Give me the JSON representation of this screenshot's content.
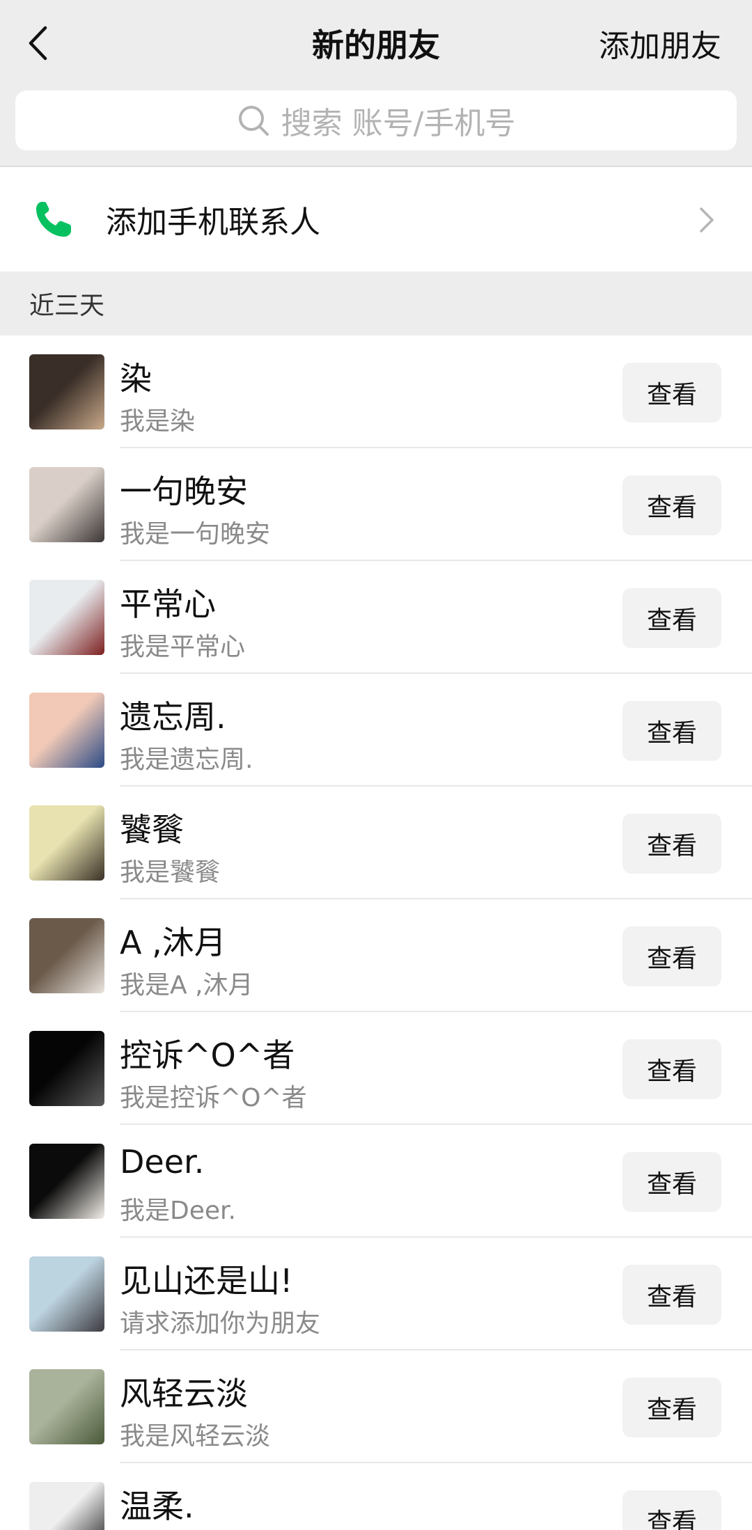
{
  "nav": {
    "title": "新的朋友",
    "action_label": "添加朋友"
  },
  "search": {
    "placeholder": "搜索 账号/手机号"
  },
  "phone_contacts": {
    "label": "添加手机联系人"
  },
  "section": {
    "label": "近三天"
  },
  "items": [
    {
      "name": "染",
      "message": "我是染",
      "button": "查看",
      "avatar_colors": [
        "#3a2e28",
        "#c9a98a"
      ]
    },
    {
      "name": "一句晚安",
      "message": "我是一句晚安",
      "button": "查看",
      "avatar_colors": [
        "#d9cfc8",
        "#3b3534"
      ]
    },
    {
      "name": "平常心",
      "message": "我是平常心",
      "button": "查看",
      "avatar_colors": [
        "#e8ecef",
        "#7d1f1f"
      ]
    },
    {
      "name": "遗忘周.",
      "message": "我是遗忘周.",
      "button": "查看",
      "avatar_colors": [
        "#f1c9b6",
        "#2b4a86"
      ]
    },
    {
      "name": "饕餮",
      "message": "我是饕餮",
      "button": "查看",
      "avatar_colors": [
        "#e7e2b0",
        "#3a3026"
      ]
    },
    {
      "name": "A ,沐月",
      "message": "我是A ,沐月",
      "button": "查看",
      "avatar_colors": [
        "#6b5a4a",
        "#e9e4de"
      ]
    },
    {
      "name": "控诉^O^者",
      "message": "我是控诉^O^者",
      "button": "查看",
      "avatar_colors": [
        "#050505",
        "#5a5a5a"
      ]
    },
    {
      "name": "Deer.",
      "message": "我是Deer.",
      "button": "查看",
      "avatar_colors": [
        "#0b0b0b",
        "#f4f0ea"
      ]
    },
    {
      "name": "见山还是山!",
      "message": "请求添加你为朋友",
      "button": "查看",
      "avatar_colors": [
        "#bcd3e0",
        "#3d3a40"
      ]
    },
    {
      "name": "风轻云淡",
      "message": "我是风轻云淡",
      "button": "查看",
      "avatar_colors": [
        "#a9b29a",
        "#4b5a3a"
      ]
    },
    {
      "name": "温柔.",
      "message": "",
      "button": "查看",
      "avatar_colors": [
        "#eeeeee",
        "#151515"
      ]
    }
  ],
  "colors": {
    "accent_green": "#07c160",
    "header_bg": "#ededed",
    "button_bg": "#f2f2f2"
  },
  "icons": {
    "back": "chevron-left-icon",
    "search": "search-icon",
    "phone": "phone-icon",
    "chevron": "chevron-right-icon"
  }
}
